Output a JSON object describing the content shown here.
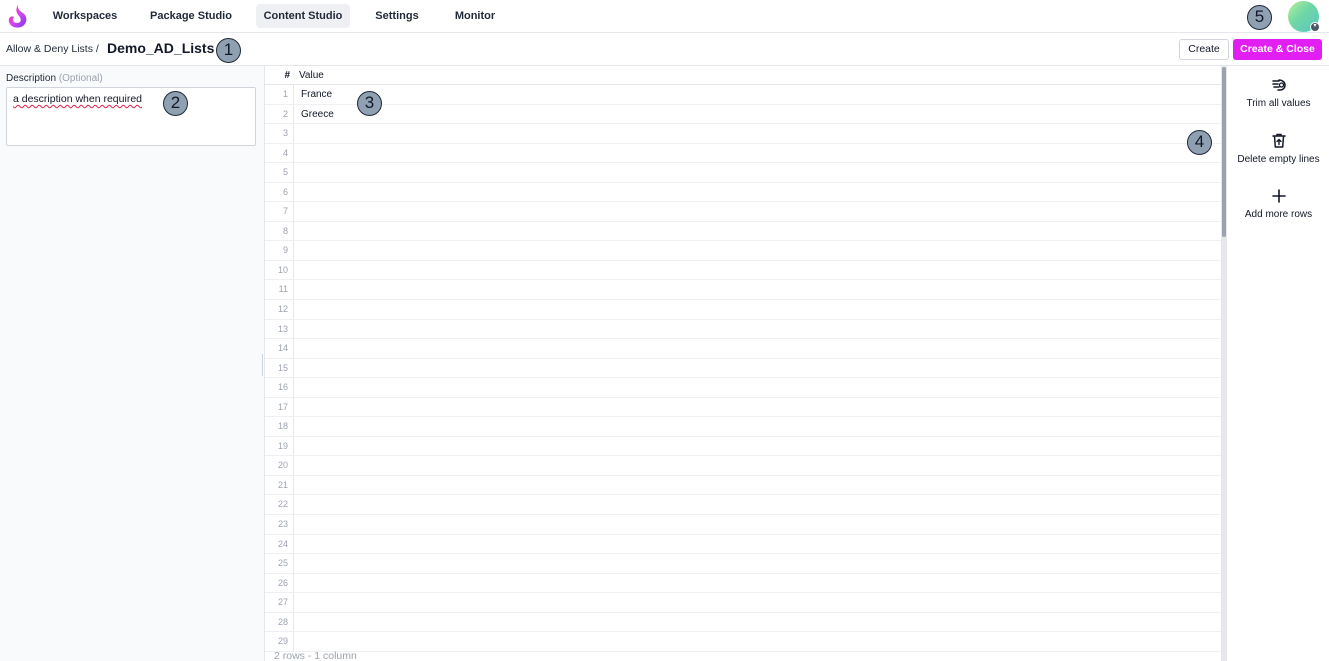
{
  "nav": {
    "items": [
      {
        "label": "Workspaces",
        "active": false
      },
      {
        "label": "Package Studio",
        "active": false
      },
      {
        "label": "Content Studio",
        "active": true
      },
      {
        "label": "Settings",
        "active": false
      },
      {
        "label": "Monitor",
        "active": false
      }
    ]
  },
  "breadcrumb": {
    "parent": "Allow & Deny Lists /",
    "title": "Demo_AD_Lists"
  },
  "toolbar": {
    "create_label": "Create",
    "create_close_label": "Create & Close"
  },
  "description": {
    "label": "Description",
    "optional": "(Optional)",
    "value": "a description when required"
  },
  "grid": {
    "header_num": "#",
    "header_value": "Value",
    "rows": [
      {
        "n": "1",
        "value": "France"
      },
      {
        "n": "2",
        "value": "Greece"
      },
      {
        "n": "3",
        "value": ""
      },
      {
        "n": "4",
        "value": ""
      },
      {
        "n": "5",
        "value": ""
      },
      {
        "n": "6",
        "value": ""
      },
      {
        "n": "7",
        "value": ""
      },
      {
        "n": "8",
        "value": ""
      },
      {
        "n": "9",
        "value": ""
      },
      {
        "n": "10",
        "value": ""
      },
      {
        "n": "11",
        "value": ""
      },
      {
        "n": "12",
        "value": ""
      },
      {
        "n": "13",
        "value": ""
      },
      {
        "n": "14",
        "value": ""
      },
      {
        "n": "15",
        "value": ""
      },
      {
        "n": "16",
        "value": ""
      },
      {
        "n": "17",
        "value": ""
      },
      {
        "n": "18",
        "value": ""
      },
      {
        "n": "19",
        "value": ""
      },
      {
        "n": "20",
        "value": ""
      },
      {
        "n": "21",
        "value": ""
      },
      {
        "n": "22",
        "value": ""
      },
      {
        "n": "23",
        "value": ""
      },
      {
        "n": "24",
        "value": ""
      },
      {
        "n": "25",
        "value": ""
      },
      {
        "n": "26",
        "value": ""
      },
      {
        "n": "27",
        "value": ""
      },
      {
        "n": "28",
        "value": ""
      },
      {
        "n": "29",
        "value": ""
      }
    ],
    "footer": "2 rows - 1 column"
  },
  "actions": {
    "trim_label": "Trim all values",
    "delete_label": "Delete empty lines",
    "add_label": "Add more rows"
  },
  "badges": [
    "1",
    "2",
    "3",
    "4",
    "5"
  ],
  "colors": {
    "accent": "#e21ff2",
    "badge": "#8fa0b3"
  }
}
